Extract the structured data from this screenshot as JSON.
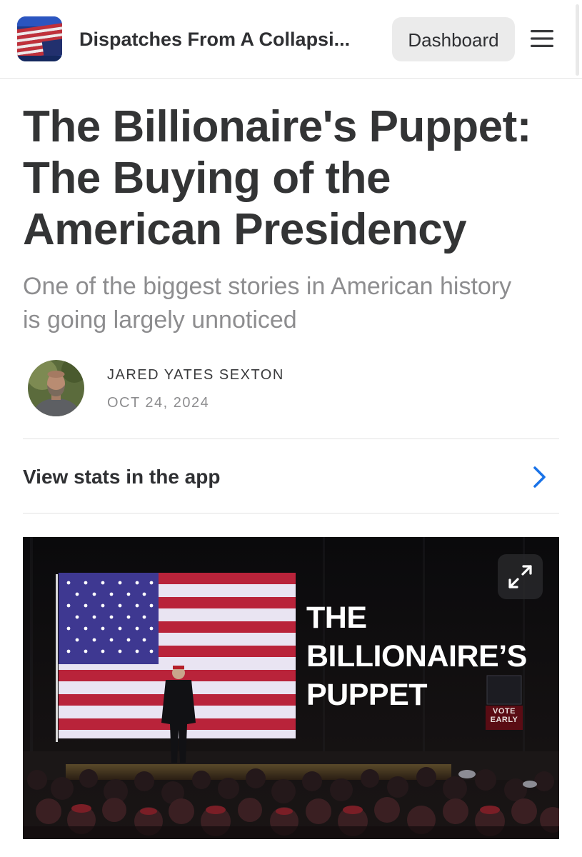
{
  "header": {
    "publication_name": "Dispatches From A Collapsi...",
    "dashboard_label": "Dashboard",
    "logo_icon": "american-flag-logo",
    "menu_icon": "hamburger-menu-icon"
  },
  "post": {
    "title_lines": [
      "The Billionaire's Puppet:",
      "The Buying of the",
      "American Presidency"
    ],
    "subtitle_lines": [
      "One of the biggest stories in American history",
      "is going largely unnoticed"
    ],
    "author": "JARED YATES SEXTON",
    "date": "OCT 24, 2024"
  },
  "stats": {
    "label": "View stats in the app",
    "chevron_icon": "chevron-right-icon"
  },
  "hero": {
    "overlay_lines": [
      "THE",
      "BILLIONAIRE’S",
      "PUPPET"
    ],
    "vote_sign": [
      "VOTE",
      "EARLY"
    ],
    "expand_icon": "expand-icon"
  },
  "colors": {
    "link_blue": "#1a73e8",
    "title_text": "#333435",
    "subtitle_gray": "#8d8d8f",
    "flag_red": "#b22234",
    "flag_blue": "#3c3b8e"
  }
}
